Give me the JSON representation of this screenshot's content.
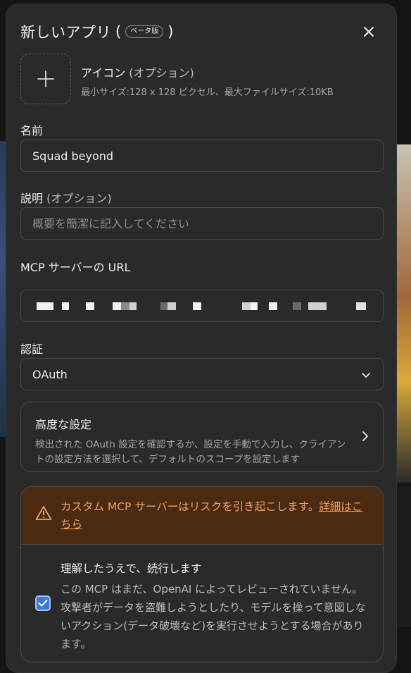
{
  "header": {
    "title": "新しいアプリ",
    "paren_open": "(",
    "beta_badge": "ベータ版",
    "paren_close": ")"
  },
  "icon_section": {
    "title": "アイコン",
    "optional": "(オプション)",
    "hint": "最小サイズ:128 x 128 ピクセル、最大ファイルサイズ:10KB"
  },
  "name_field": {
    "label": "名前",
    "value": "Squad beyond"
  },
  "description_field": {
    "label": "説明",
    "optional": "(オプション)",
    "placeholder": "概要を簡潔に記入してください"
  },
  "url_field": {
    "label": "MCP サーバーの URL"
  },
  "auth_field": {
    "label": "認証",
    "selected": "OAuth"
  },
  "advanced": {
    "title": "高度な設定",
    "description": "検出された OAuth 設定を確認するか、設定を手動で入力し、クライアントの設定方法を選択して、デフォルトのスコープを設定します"
  },
  "warning": {
    "text": "カスタム MCP サーバーはリスクを引き起こします。",
    "link": "詳細はこちら"
  },
  "acknowledge": {
    "title": "理解したうえで、続行します",
    "description": "この MCP はまだ、OpenAI によってレビューされていません。攻撃者がデータを盗難しようとしたり、モデルを操って意図しないアクション(データ破壊など)を実行させようとする場合があります。",
    "checked": true
  },
  "colors": {
    "modal_bg": "#2a2a2a",
    "warning_bg": "#4a2a10",
    "warning_text": "#f0a060",
    "checkbox_accent": "#3a7bd5"
  }
}
